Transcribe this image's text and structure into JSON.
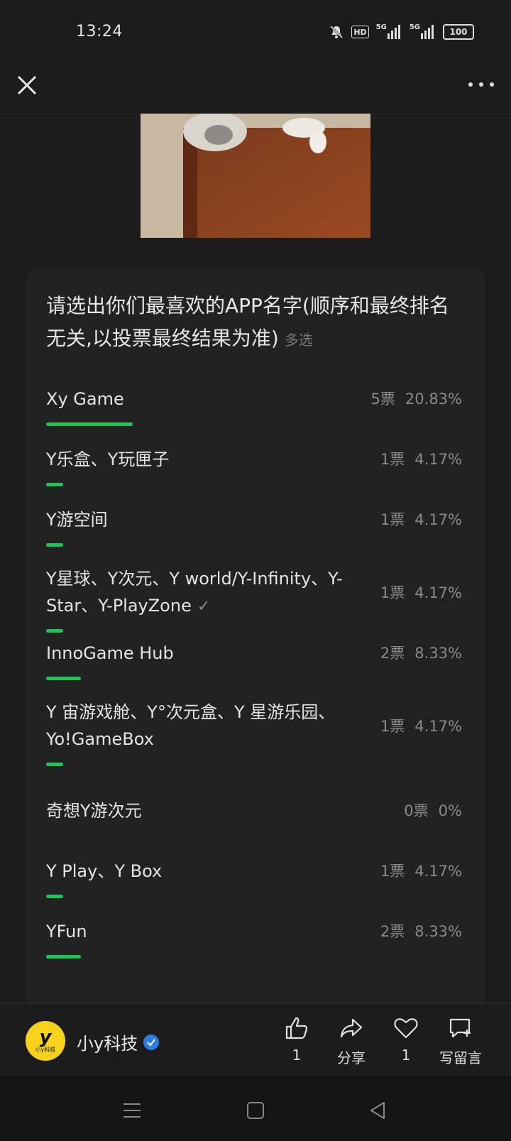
{
  "status_bar": {
    "time": "13:24",
    "icons": [
      "bell-muted-icon",
      "hd-icon",
      "signal-5g-icon",
      "signal-5g-icon"
    ],
    "hd_label": "HD",
    "net1": "5G",
    "net2": "5G",
    "battery": "100"
  },
  "poll": {
    "title": "请选出你们最喜欢的APP名字(顺序和最终排名无关,以投票最终结果为准)",
    "multi_label": "多选",
    "options": [
      {
        "label": "Xy Game",
        "votes": "5票",
        "percent": "20.83%",
        "share": 0.2083
      },
      {
        "label": "Y乐盒、Y玩匣子",
        "votes": "1票",
        "percent": "4.17%",
        "share": 0.0417
      },
      {
        "label": "Y游空间",
        "votes": "1票",
        "percent": "4.17%",
        "share": 0.0417
      },
      {
        "label": "Y星球、Y次元、Y world/Y-Infinity、Y-Star、Y-PlayZone",
        "votes": "1票",
        "percent": "4.17%",
        "share": 0.0417,
        "selected": true
      },
      {
        "label": "InnoGame Hub",
        "votes": "2票",
        "percent": "8.33%",
        "share": 0.0833
      },
      {
        "label": "Y 宙游戏舱、Y°次元盒、Y 星游乐园、Yo!GameBox",
        "votes": "1票",
        "percent": "4.17%",
        "share": 0.0417
      },
      {
        "label": "奇想Y游次元",
        "votes": "0票",
        "percent": "0%",
        "share": 0
      },
      {
        "label": "Y Play、Y Box",
        "votes": "1票",
        "percent": "4.17%",
        "share": 0.0417
      },
      {
        "label": "YFun",
        "votes": "2票",
        "percent": "8.33%",
        "share": 0.0833
      }
    ]
  },
  "author": {
    "name": "小y科技",
    "avatar_text": "y",
    "avatar_sub": "小y科技"
  },
  "actions": {
    "like_count": "1",
    "share_label": "分享",
    "favorite_count": "1",
    "comment_label": "写留言"
  },
  "colors": {
    "accent": "#1ec65a",
    "background": "#1c1c1c",
    "card": "#222222",
    "verified": "#2a7de1",
    "avatar": "#f7d21c"
  }
}
